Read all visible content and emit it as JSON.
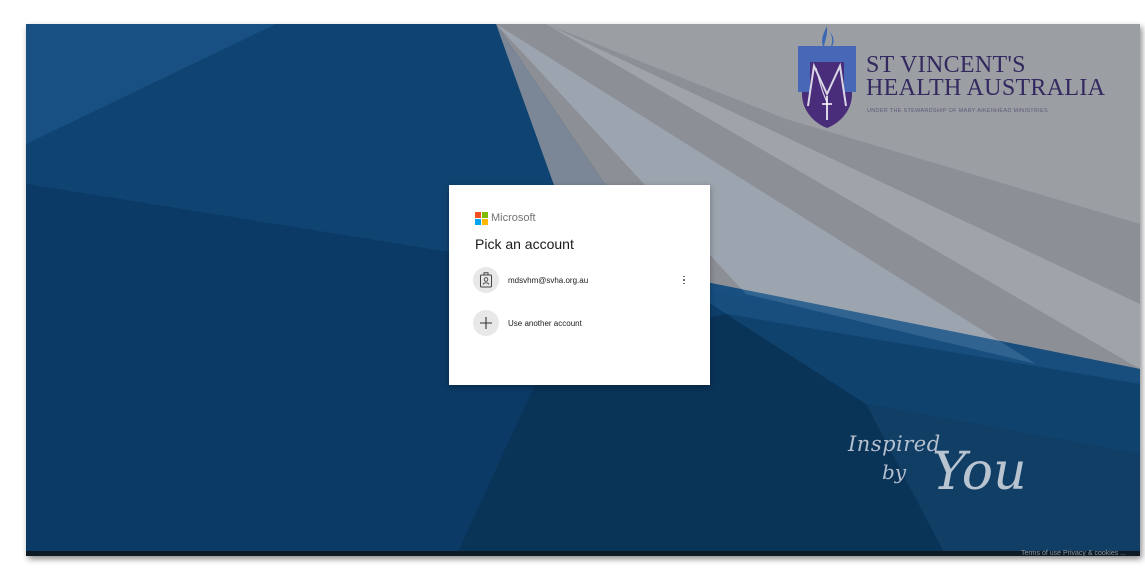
{
  "organization": {
    "name_line1": "ST VINCENT'S",
    "name_line2": "HEALTH AUSTRALIA",
    "tagline": "UNDER THE STEWARDSHIP OF MARY AIKENHEAD MINISTRIES"
  },
  "slogan": {
    "word1": "Inspired",
    "word2": "by",
    "word3": "You"
  },
  "dialog": {
    "brand": "Microsoft",
    "title": "Pick an account",
    "accounts": [
      {
        "email": "mdsvhm@svha.org.au",
        "icon": "badge-icon"
      }
    ],
    "use_another_label": "Use another account",
    "more_options_icon": "more-vertical-icon",
    "add_icon": "plus-icon"
  },
  "footer": {
    "text": "Terms of use   Privacy & cookies   ..."
  },
  "colors": {
    "ms_red": "#f25022",
    "ms_green": "#7fba00",
    "ms_blue": "#00a4ef",
    "ms_yellow": "#ffb900",
    "brand_purple": "#33285f"
  }
}
